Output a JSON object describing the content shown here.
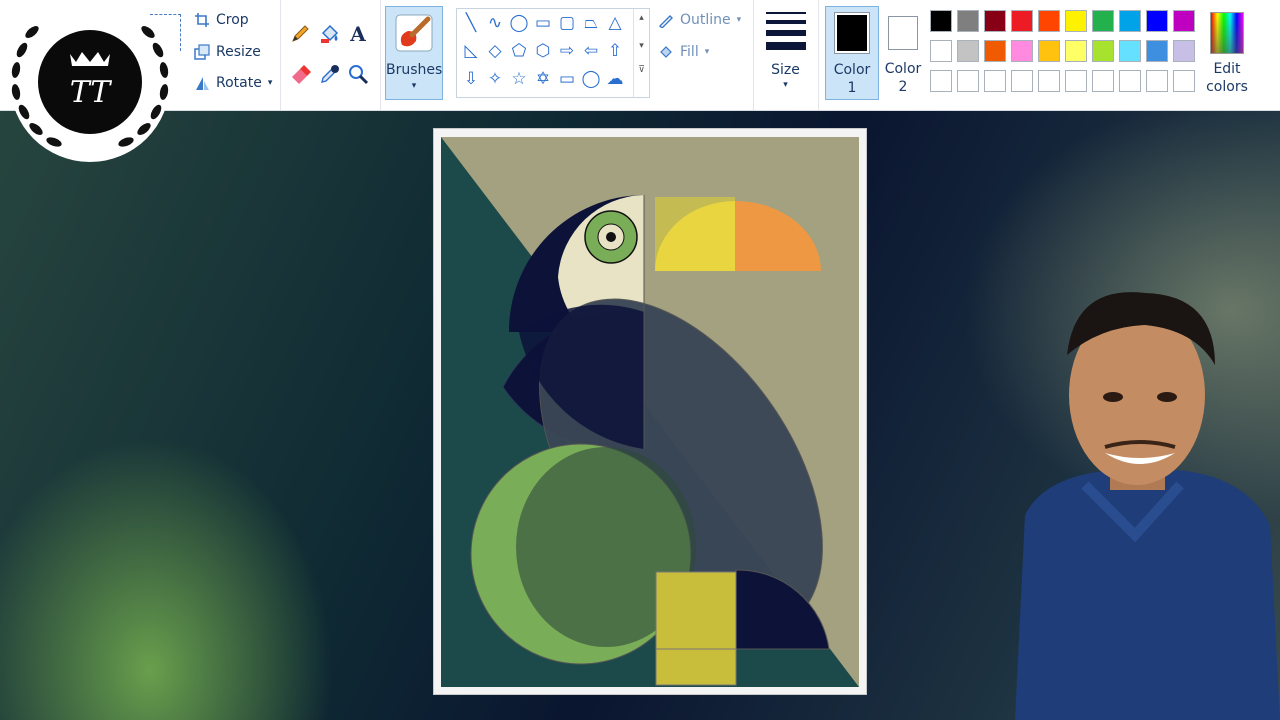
{
  "ribbon": {
    "image_tools": {
      "crop_label": "Crop",
      "resize_label": "Resize",
      "rotate_label": "Rotate"
    },
    "tools": {
      "pencil": "pencil-icon",
      "fill": "fill-bucket-icon",
      "text": "A",
      "eraser": "eraser-icon",
      "color_picker": "color-picker-icon",
      "magnifier": "magnifier-icon"
    },
    "brushes_label": "Brushes",
    "shapes": {
      "outline_label": "Outline",
      "fill_label": "Fill"
    },
    "size_label": "Size",
    "color1_label": "Color\n1",
    "color1_line1": "Color",
    "color1_line2": "1",
    "color2_line1": "Color",
    "color2_line2": "2",
    "edit_colors_line1": "Edit",
    "edit_colors_line2": "colors",
    "color1_value": "#000000",
    "color2_value": "#ffffff",
    "palette_row1": [
      "#000000",
      "#7f7f7f",
      "#880015",
      "#ed1c24",
      "#ff4500",
      "#fff200",
      "#22b14c",
      "#00a2e8",
      "#0000ff",
      "#c000c0"
    ],
    "palette_row2": [
      "#ffffff",
      "#c3c3c3",
      "#f05a00",
      "#ff8adf",
      "#ffc20e",
      "#ffff66",
      "#a6e22e",
      "#66e0ff",
      "#3f8fe0",
      "#c8bfe7"
    ],
    "palette_row3": [
      "#ffffff",
      "#ffffff",
      "#ffffff",
      "#ffffff",
      "#ffffff",
      "#ffffff",
      "#ffffff",
      "#ffffff",
      "#ffffff",
      "#ffffff"
    ]
  },
  "canvas": {
    "subject": "toucan-drawing",
    "colors": {
      "background": "#a3a17f",
      "dark_teal": "#1c4a4a",
      "navy": "#0c1238",
      "slate": "#3a4656",
      "cream": "#e8e3c5",
      "green": "#7aad58",
      "yellow": "#e8d540",
      "orange": "#ee9844",
      "olive_yellow": "#c9be3c"
    }
  },
  "overlay": {
    "logo_monogram": "TT"
  }
}
